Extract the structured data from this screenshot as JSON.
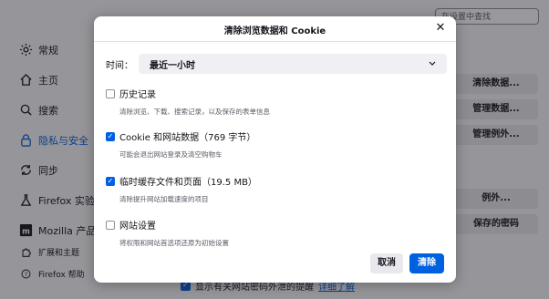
{
  "background": {
    "search_placeholder": "在设置中查找",
    "nav": [
      {
        "label": "常规",
        "icon": "gear-icon"
      },
      {
        "label": "主页",
        "icon": "home-icon"
      },
      {
        "label": "搜索",
        "icon": "search-icon"
      },
      {
        "label": "隐私与安全",
        "icon": "lock-icon"
      },
      {
        "label": "同步",
        "icon": "sync-icon"
      },
      {
        "label": "Firefox 实验室",
        "icon": "flask-icon"
      },
      {
        "label": "Mozilla 产品",
        "icon": "mozilla-icon"
      }
    ],
    "footer_nav": [
      {
        "label": "扩展和主题",
        "icon": "puzzle-icon"
      },
      {
        "label": "Firefox 帮助",
        "icon": "help-icon"
      }
    ],
    "side_buttons": [
      "清除数据...",
      "管理数据...",
      "管理例外...",
      "例外...",
      "保存的密码"
    ],
    "bottom_checkbox_label": "显示有关网站密码外泄的提醒",
    "bottom_link": "详细了解"
  },
  "dialog": {
    "title": "清除浏览数据和 Cookie",
    "time_label": "时间：",
    "time_value": "最近一小时",
    "options": [
      {
        "label": "历史记录",
        "desc": "清除浏览、下载、搜索记录，以及保存的表单信息",
        "checked": false
      },
      {
        "label": "Cookie 和网站数据（769 字节）",
        "desc": "可能会退出网站登录及清空购物车",
        "checked": true
      },
      {
        "label": "临时缓存文件和页面（19.5 MB）",
        "desc": "清除提升网站加载速度的项目",
        "checked": true
      },
      {
        "label": "网站设置",
        "desc": "将权限和网站首选项还原为初始设置",
        "checked": false
      }
    ],
    "cancel_label": "取消",
    "clear_label": "清除"
  }
}
